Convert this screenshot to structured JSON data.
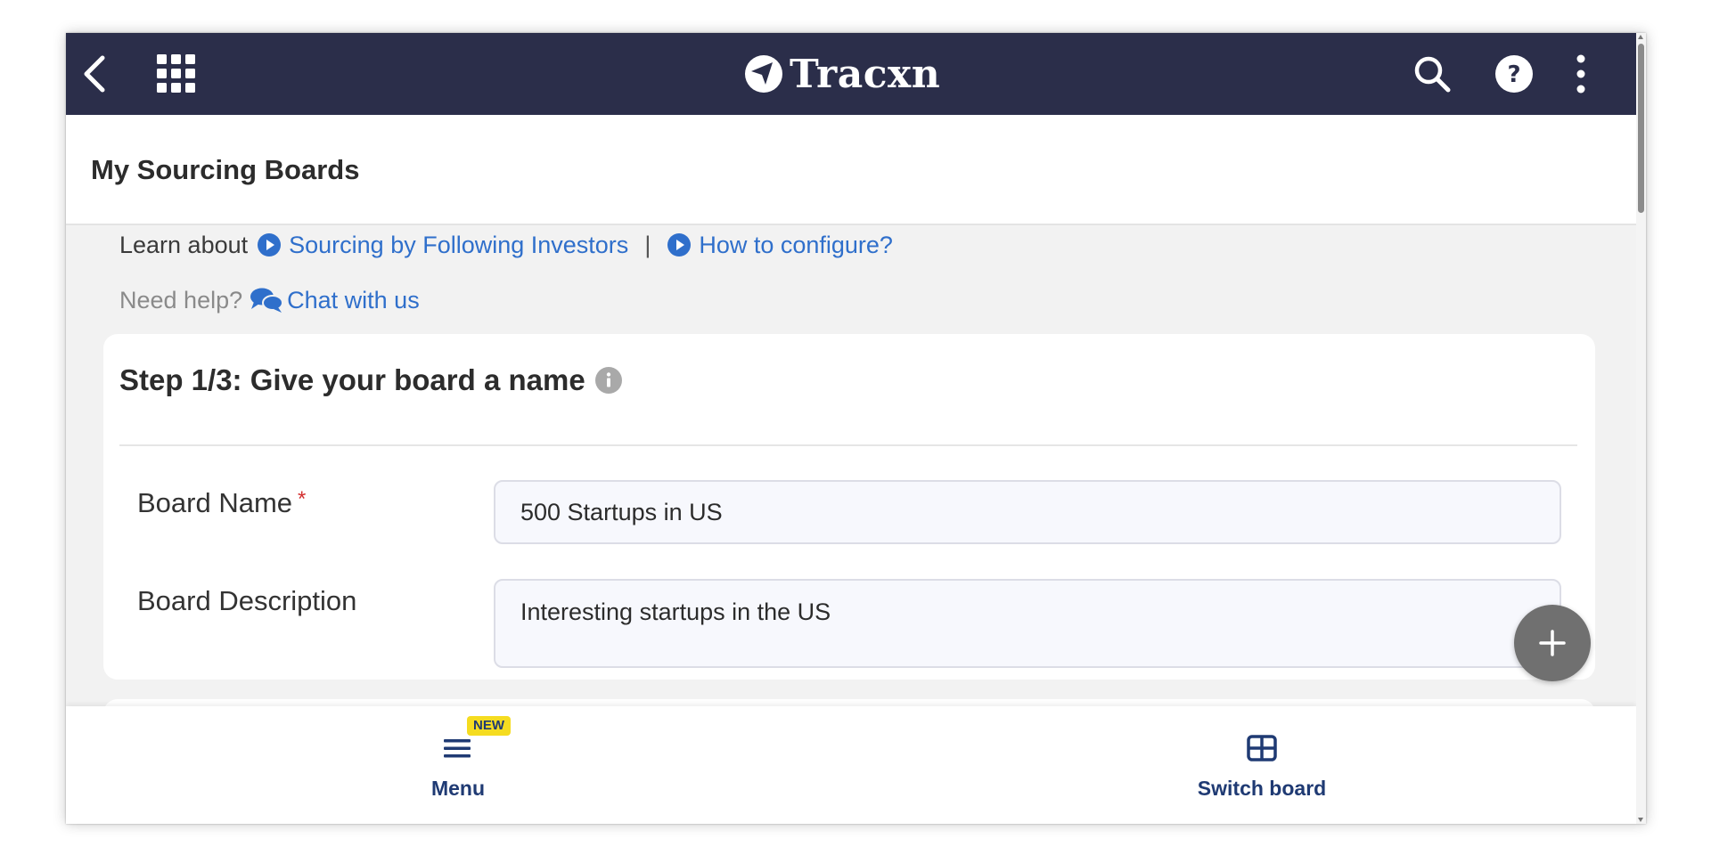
{
  "colors": {
    "topbar": "#2b2e4a",
    "link": "#2f6fcb",
    "nav_text": "#1f3a73",
    "badge": "#f5dc20",
    "fab": "#707070",
    "required": "#d32f2f"
  },
  "topbar": {
    "logo_text": "Tracxn",
    "icons": [
      "chevron-left-icon",
      "apps-grid-icon",
      "search-icon",
      "help-icon",
      "more-vertical-icon"
    ]
  },
  "header": {
    "title": "My Sourcing Boards"
  },
  "learn": {
    "prefix": "Learn about",
    "link1": "Sourcing by Following Investors",
    "separator": "|",
    "link2": "How to configure?"
  },
  "help": {
    "prefix": "Need help?",
    "link": "Chat with us"
  },
  "step1": {
    "title": "Step 1/3: Give your board a name",
    "fields": {
      "name_label": "Board Name",
      "name_required": "*",
      "name_value": "500 Startups in US",
      "desc_label": "Board Description",
      "desc_value": "Interesting startups in the US"
    }
  },
  "bottom_nav": {
    "menu_label": "Menu",
    "menu_badge": "NEW",
    "switch_label": "Switch board"
  }
}
